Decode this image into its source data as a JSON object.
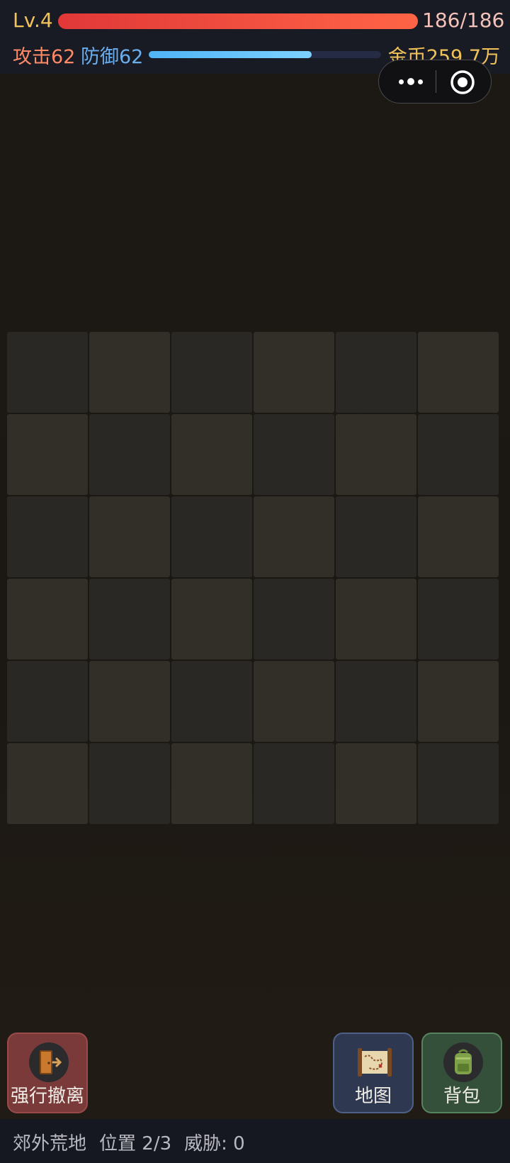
{
  "status": {
    "level": "Lv.4",
    "hp_text": "186/186",
    "hp_fraction": 1.0,
    "attack": "攻击62",
    "defense": "防御62",
    "exp_fraction": 0.7,
    "gold": "金币259.7万"
  },
  "capsule": {
    "more_icon": "more-dots-icon",
    "close_icon": "target-close-icon"
  },
  "grid": {
    "rows": 6,
    "cols": 6
  },
  "actions": {
    "retreat_label": "强行撤离",
    "map_label": "地图",
    "bag_label": "背包"
  },
  "footer": {
    "area": "郊外荒地",
    "position": "位置 2/3",
    "threat": "威胁: 0"
  },
  "colors": {
    "hp": "#e13838",
    "exp": "#4fb4f6",
    "gold": "#f2c25a",
    "attack": "#ff8a66",
    "defense": "#6aaeef"
  }
}
